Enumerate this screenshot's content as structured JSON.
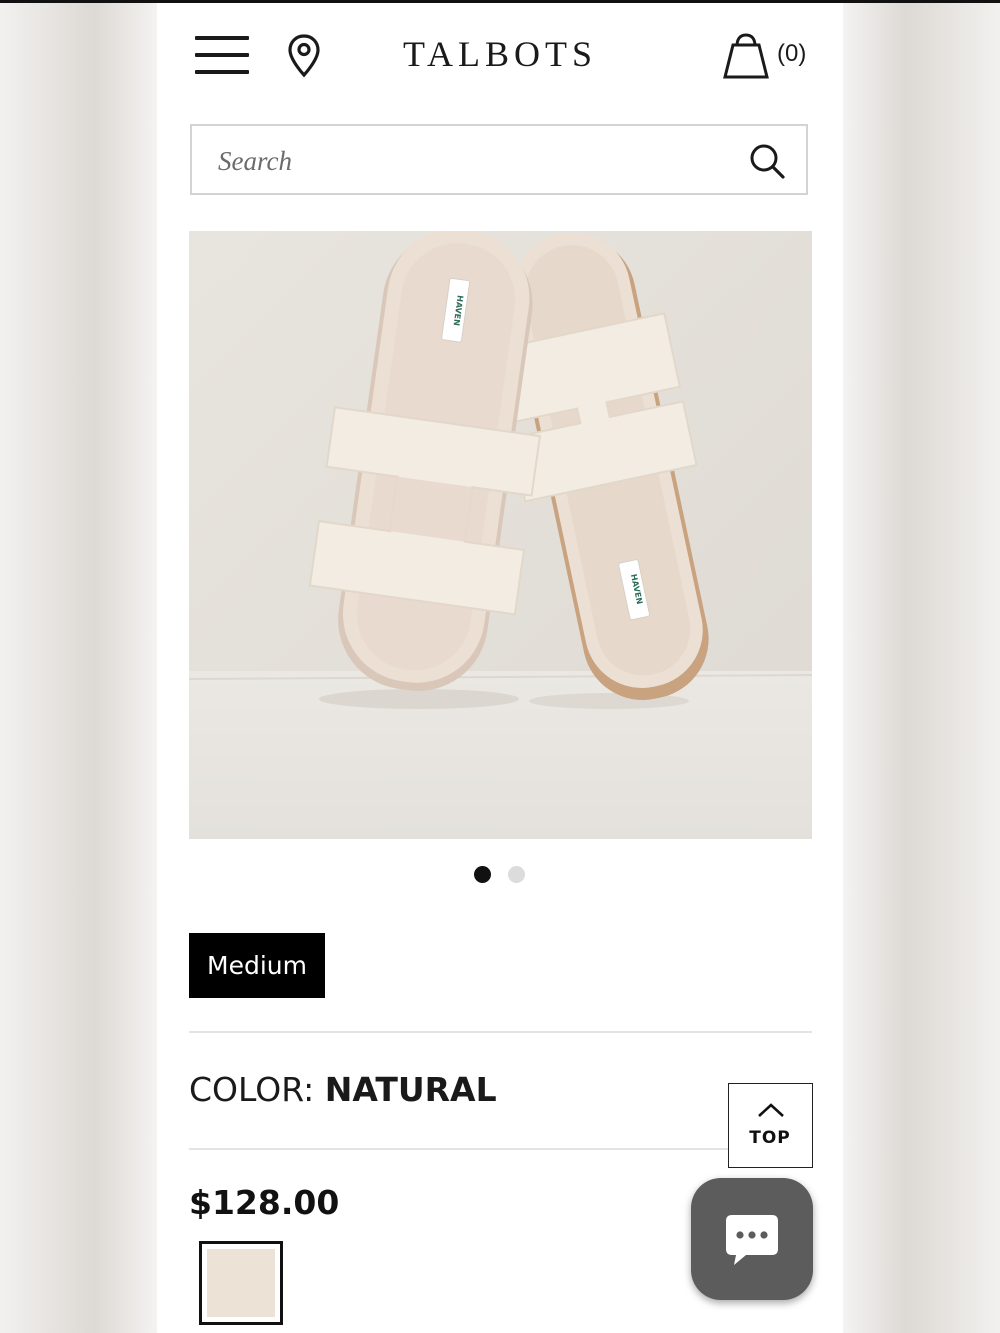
{
  "header": {
    "logo": "TALBOTS",
    "cart_count": "(0)",
    "icons": [
      "hamburger-menu-icon",
      "location-pin-icon",
      "shopping-bag-icon"
    ]
  },
  "search": {
    "placeholder": "Search",
    "value": ""
  },
  "gallery": {
    "image_count": 2,
    "active_index": 0,
    "label_text": "HAVEN"
  },
  "product": {
    "size_label": "Medium",
    "color_prefix": "COLOR:",
    "color_value": "NATURAL",
    "price": "$128.00",
    "swatch_color": "#ede2d6"
  },
  "controls": {
    "top_label": "TOP"
  },
  "colors": {
    "text": "#1a1a1a",
    "divider": "#e3e3e3",
    "chat_bg": "#5c5c5c"
  }
}
